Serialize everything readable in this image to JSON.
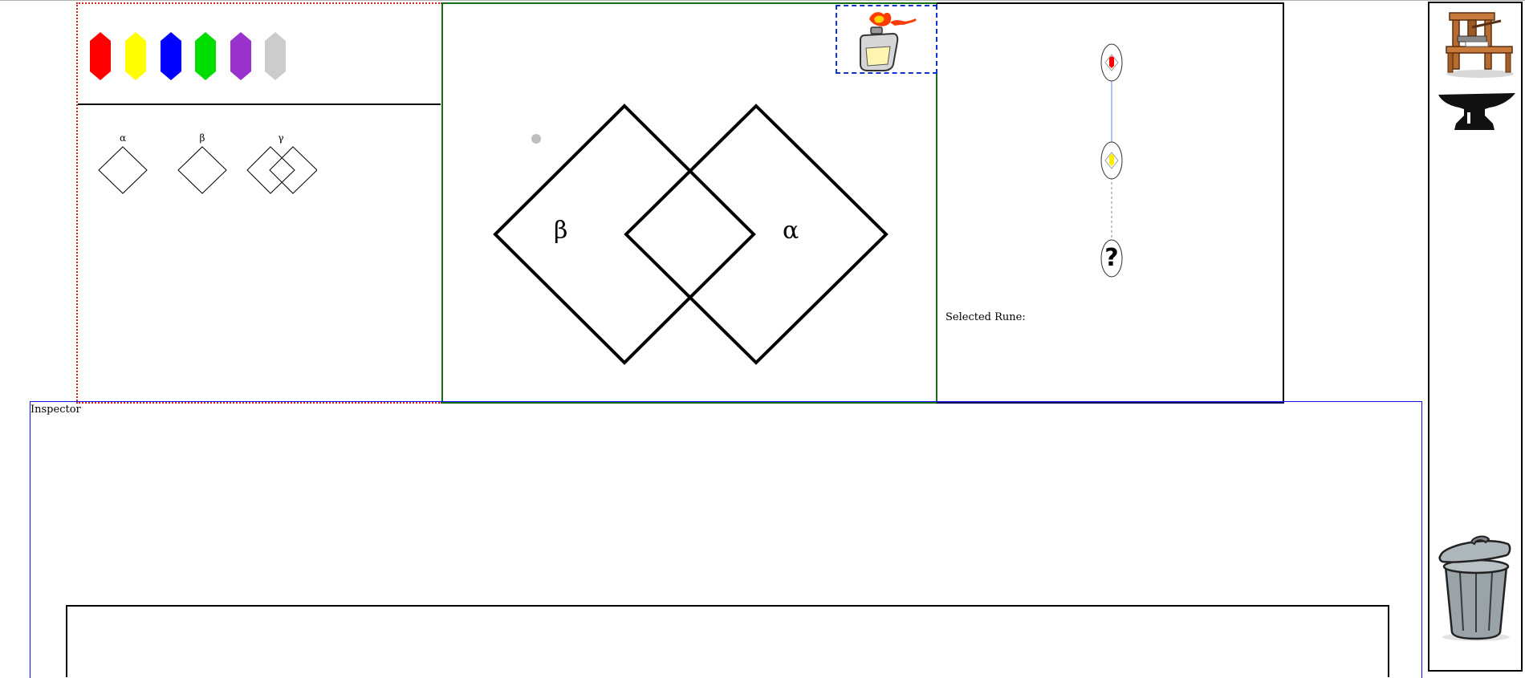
{
  "palette": {
    "gems": [
      {
        "name": "red",
        "color": "#ff0000"
      },
      {
        "name": "yellow",
        "color": "#ffff00"
      },
      {
        "name": "blue",
        "color": "#0000ff"
      },
      {
        "name": "green",
        "color": "#00dd00"
      },
      {
        "name": "purple",
        "color": "#9932cc"
      },
      {
        "name": "gray",
        "color": "#cccccc"
      }
    ]
  },
  "runes": [
    {
      "letter": "α"
    },
    {
      "letter": "β"
    },
    {
      "letter": "γ"
    }
  ],
  "editor": {
    "left_label": "β",
    "right_label": "α"
  },
  "preview": {
    "question_mark": "?",
    "selected_rune_label": "Selected Rune:"
  },
  "inspector": {
    "title": "Inspector"
  },
  "tools": {
    "printing_press_icon": "printing-press-icon",
    "anvil_icon": "anvil-icon",
    "trash_icon": "trash-can-icon"
  }
}
